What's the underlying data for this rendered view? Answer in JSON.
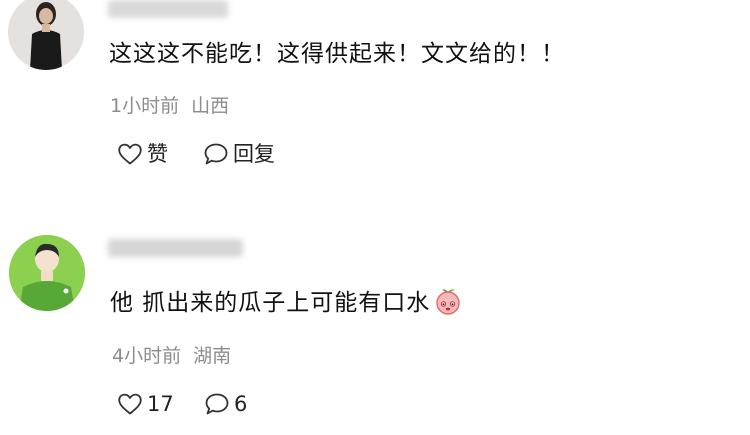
{
  "comments": [
    {
      "content": "这这这不能吃！这得供起来！文文给的！！",
      "time": "1小时前",
      "location": "山西",
      "like_label": "赞",
      "reply_label": "回复"
    },
    {
      "content": "他 抓出来的瓜子上可能有口水",
      "time": "4小时前",
      "location": "湖南",
      "like_label": "17",
      "reply_label": "6"
    }
  ],
  "colors": {
    "meta_text": "#8c8c8c",
    "avatar2_bg": "#8cd050",
    "avatar2_shirt": "#58a838"
  },
  "icons": [
    "heart-icon",
    "speech-bubble-icon",
    "peach-emoji"
  ]
}
